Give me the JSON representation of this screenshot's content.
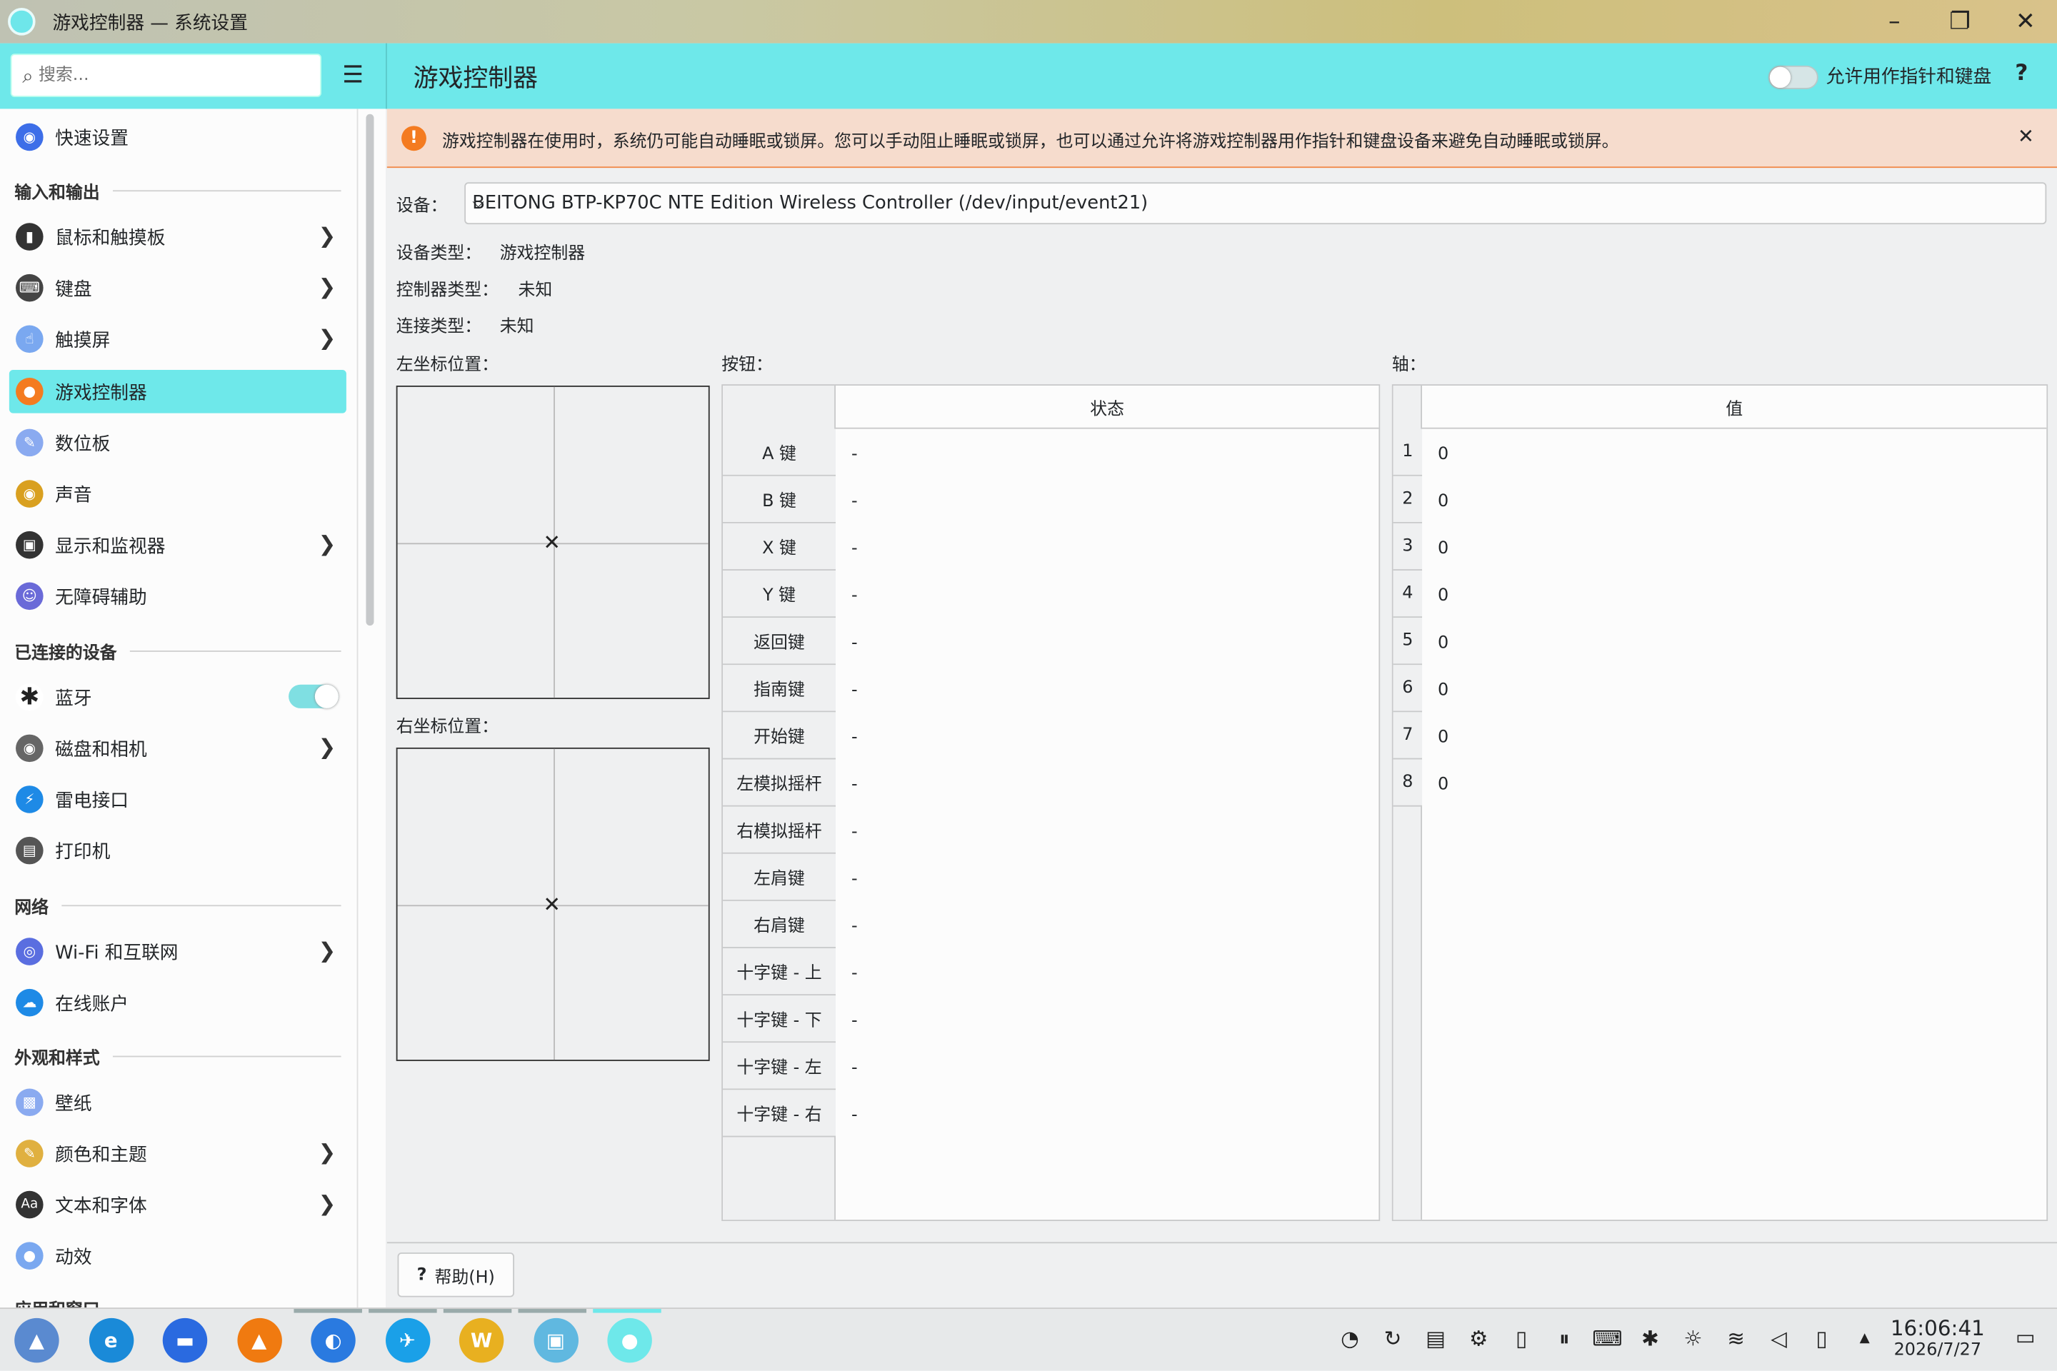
{
  "window": {
    "title": "游戏控制器 — 系统设置",
    "minimize_icon": "–",
    "maximize_icon": "❐",
    "close_icon": "✕"
  },
  "header": {
    "search_placeholder": "搜索...",
    "page_title": "游戏控制器",
    "allow_pointer_label": "允许用作指针和键盘",
    "allow_pointer_enabled": false,
    "help_icon": "?"
  },
  "sidebar": {
    "quick": {
      "label": "快速设置",
      "color": "#3d6ee8"
    },
    "sections": [
      {
        "title": "输入和输出"
      },
      {
        "title": "已连接的设备"
      },
      {
        "title": "网络"
      },
      {
        "title": "外观和样式"
      },
      {
        "title": "应用和窗口"
      }
    ],
    "items": [
      {
        "label": "鼠标和触摸板",
        "icon": "mouse-icon",
        "color": "#333"
      },
      {
        "label": "键盘",
        "icon": "keyboard-icon",
        "color": "#444"
      },
      {
        "label": "触摸屏",
        "icon": "touch-icon",
        "color": "#7aa8f0"
      },
      {
        "label": "游戏控制器",
        "icon": "gamepad-icon",
        "color": "#f47b20"
      },
      {
        "label": "数位板",
        "icon": "tablet-icon",
        "color": "#8aaaf0"
      },
      {
        "label": "声音",
        "icon": "speaker-icon",
        "color": "#d9a020"
      },
      {
        "label": "显示和监视器",
        "icon": "display-icon",
        "color": "#333"
      },
      {
        "label": "无障碍辅助",
        "icon": "accessibility-icon",
        "color": "#6a6ad8"
      },
      {
        "label": "蓝牙",
        "icon": "bluetooth-icon",
        "color": "#222"
      },
      {
        "label": "磁盘和相机",
        "icon": "disk-icon",
        "color": "#666"
      },
      {
        "label": "雷电接口",
        "icon": "thunderbolt-icon",
        "color": "#1e8ae6"
      },
      {
        "label": "打印机",
        "icon": "printer-icon",
        "color": "#555"
      },
      {
        "label": "Wi-Fi 和互联网",
        "icon": "globe-icon",
        "color": "#5a6ee0"
      },
      {
        "label": "在线账户",
        "icon": "cloud-icon",
        "color": "#1e8ae6"
      },
      {
        "label": "壁纸",
        "icon": "wallpaper-icon",
        "color": "#8aaaf0"
      },
      {
        "label": "颜色和主题",
        "icon": "palette-icon",
        "color": "#e0b040"
      },
      {
        "label": "文本和字体",
        "icon": "font-icon",
        "color": "#333"
      },
      {
        "label": "动效",
        "icon": "animation-icon",
        "color": "#7aa8f0"
      }
    ],
    "bluetooth_enabled": true
  },
  "banner": {
    "text": "游戏控制器在使用时，系统仍可能自动睡眠或锁屏。您可以手动阻止睡眠或锁屏，也可以通过允许将游戏控制器用作指针和键盘设备来避免自动睡眠或锁屏。",
    "warning_icon": "!",
    "close_icon": "✕",
    "color": "#f47b20"
  },
  "device": {
    "label": "设备：",
    "selected": "BEITONG BTP-KP70C NTE Edition Wireless Controller (/dev/input/event21)",
    "type_label": "设备类型：",
    "type_value": "游戏控制器",
    "controller_label": "控制器类型：",
    "controller_value": "未知",
    "connection_label": "连接类型：",
    "connection_value": "未知"
  },
  "pads": {
    "left_label": "左坐标位置：",
    "right_label": "右坐标位置：",
    "left_x": 0,
    "left_y": 0,
    "right_x": 0,
    "right_y": 0
  },
  "buttons": {
    "label": "按钮：",
    "column": "状态",
    "rows": [
      {
        "name": "A 键",
        "state": "-"
      },
      {
        "name": "B 键",
        "state": "-"
      },
      {
        "name": "X 键",
        "state": "-"
      },
      {
        "name": "Y 键",
        "state": "-"
      },
      {
        "name": "返回键",
        "state": "-"
      },
      {
        "name": "指南键",
        "state": "-"
      },
      {
        "name": "开始键",
        "state": "-"
      },
      {
        "name": "左模拟摇杆",
        "state": "-"
      },
      {
        "name": "右模拟摇杆",
        "state": "-"
      },
      {
        "name": "左肩键",
        "state": "-"
      },
      {
        "name": "右肩键",
        "state": "-"
      },
      {
        "name": "十字键 - 上",
        "state": "-"
      },
      {
        "name": "十字键 - 下",
        "state": "-"
      },
      {
        "name": "十字键 - 左",
        "state": "-"
      },
      {
        "name": "十字键 - 右",
        "state": "-"
      }
    ]
  },
  "axes": {
    "label": "轴：",
    "column": "值",
    "rows": [
      {
        "index": "1",
        "value": "0"
      },
      {
        "index": "2",
        "value": "0"
      },
      {
        "index": "3",
        "value": "0"
      },
      {
        "index": "4",
        "value": "0"
      },
      {
        "index": "5",
        "value": "0"
      },
      {
        "index": "6",
        "value": "0"
      },
      {
        "index": "7",
        "value": "0"
      },
      {
        "index": "8",
        "value": "0"
      }
    ]
  },
  "footer": {
    "help_label": "帮助(H)",
    "help_icon": "?"
  },
  "taskbar": {
    "apps": [
      {
        "name": "launcher",
        "color": "#5a8ad0",
        "glyph": "▲"
      },
      {
        "name": "edge",
        "color": "#1a8ad8",
        "glyph": "e"
      },
      {
        "name": "files",
        "color": "#2a6ae0",
        "glyph": "▬"
      },
      {
        "name": "vlc",
        "color": "#f07a10",
        "glyph": "▲"
      },
      {
        "name": "app5",
        "color": "#2a7ae0",
        "glyph": "◐"
      },
      {
        "name": "app6",
        "color": "#1aa0e8",
        "glyph": "✈"
      },
      {
        "name": "app7",
        "color": "#e8b020",
        "glyph": "W"
      },
      {
        "name": "app8",
        "color": "#60b8e0",
        "glyph": "▣"
      },
      {
        "name": "settings",
        "color": "#6ee8ea",
        "glyph": "●"
      }
    ],
    "tray_icons": [
      "clock-icon",
      "sync-icon",
      "monitor-icon",
      "gear-icon",
      "clipboard-icon",
      "pause-icon",
      "keyboard-icon",
      "bluetooth-icon",
      "brightness-icon",
      "wifi-icon",
      "volume-icon",
      "phone-icon",
      "arrow-up-icon"
    ],
    "time": "16:06:41",
    "date": "2026/7/27"
  }
}
